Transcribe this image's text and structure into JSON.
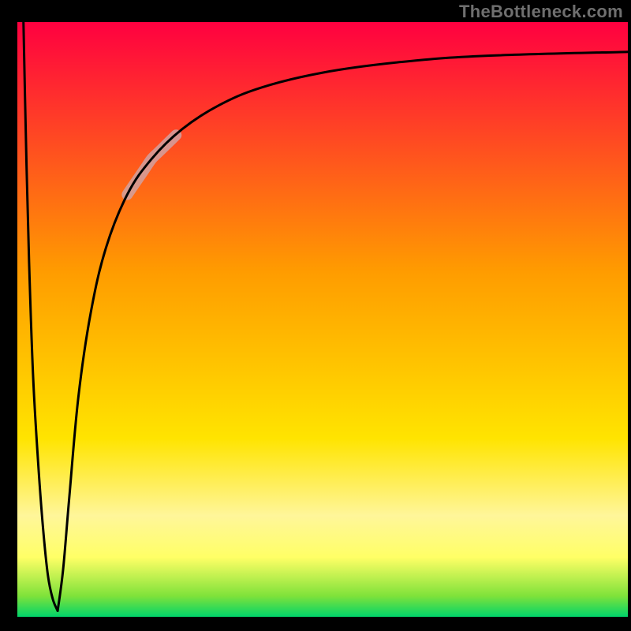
{
  "watermark": "TheBottleneck.com",
  "chart_data": {
    "type": "line",
    "title": "",
    "xlabel": "",
    "ylabel": "",
    "xlim": [
      0,
      100
    ],
    "ylim": [
      0,
      100
    ],
    "grid": false,
    "legend": false,
    "background_gradient": {
      "stops": [
        {
          "offset": 0.0,
          "color": "#ff0040"
        },
        {
          "offset": 0.42,
          "color": "#ff9c00"
        },
        {
          "offset": 0.7,
          "color": "#ffe400"
        },
        {
          "offset": 0.83,
          "color": "#fff69a"
        },
        {
          "offset": 0.9,
          "color": "#ffff66"
        },
        {
          "offset": 0.965,
          "color": "#7fe23a"
        },
        {
          "offset": 1.0,
          "color": "#00d46a"
        }
      ]
    },
    "series": [
      {
        "name": "curve-left",
        "x": [
          1.0,
          1.2,
          1.5,
          2.0,
          2.6,
          3.4,
          4.2,
          5.0,
          5.8,
          6.6
        ],
        "y": [
          100,
          90,
          76,
          57,
          40,
          26,
          15,
          7,
          3,
          1
        ]
      },
      {
        "name": "curve-right",
        "x": [
          6.6,
          7.5,
          8.5,
          10.0,
          12.0,
          14.5,
          18.0,
          22.0,
          27.0,
          33.0,
          40.0,
          50.0,
          62.0,
          76.0,
          100.0
        ],
        "y": [
          1,
          8,
          20,
          37,
          51,
          62,
          71,
          77,
          82,
          86,
          89,
          91.5,
          93.2,
          94.3,
          95.0
        ]
      }
    ],
    "highlight_segment": {
      "series": "curve-right",
      "x_range": [
        18,
        26
      ],
      "color": "#d0a4a6",
      "opacity": 0.82
    }
  }
}
